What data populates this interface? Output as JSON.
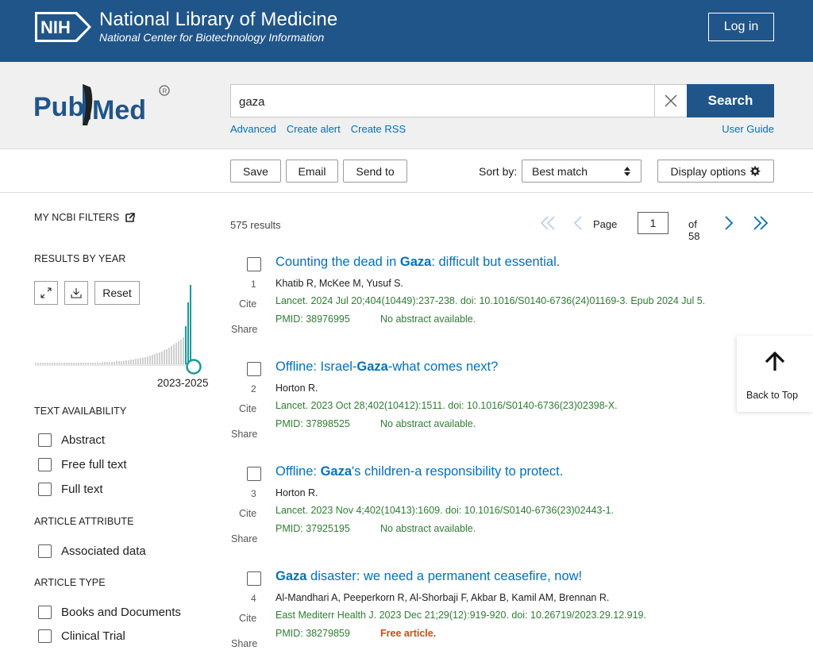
{
  "header": {
    "badge_text": "NIH",
    "title": "National Library of Medicine",
    "subtitle": "National Center for Biotechnology Information",
    "login_label": "Log in",
    "brand_color": "#20558a"
  },
  "search": {
    "logo_text": "PubMed",
    "query": "gaza",
    "button_label": "Search",
    "links": [
      "Advanced",
      "Create alert",
      "Create RSS"
    ],
    "user_guide": "User Guide"
  },
  "actions": {
    "save": "Save",
    "email": "Email",
    "send_to": "Send to",
    "sort_label": "Sort by:",
    "sort_value": "Best match",
    "display_options": "Display options"
  },
  "sidebar": {
    "my_filters": "MY NCBI FILTERS",
    "results_by_year": "RESULTS BY YEAR",
    "reset": "Reset",
    "year_range": "2023-2025",
    "text_availability": "TEXT AVAILABILITY",
    "text_filters": [
      "Abstract",
      "Free full text",
      "Full text"
    ],
    "article_attribute": "ARTICLE ATTRIBUTE",
    "attribute_filters": [
      "Associated data"
    ],
    "article_type": "ARTICLE TYPE",
    "type_filters": [
      "Books and Documents",
      "Clinical Trial"
    ]
  },
  "results_info": {
    "count": "575 results",
    "page_label": "Page",
    "page_value": "1",
    "page_of": "of 58"
  },
  "results": [
    {
      "num": "1",
      "title_pre": "Counting the dead in ",
      "title_bold": "Gaza",
      "title_post": ": difficult but essential.",
      "authors": "Khatib R, McKee M, Yusuf S.",
      "citation": "Lancet. 2024 Jul 20;404(10449):237-238. doi: 10.1016/S0140-6736(24)01169-3. Epub 2024 Jul 5.",
      "pmid": "PMID: 38976995",
      "note": "No abstract available.",
      "cite": "Cite",
      "share": "Share"
    },
    {
      "num": "2",
      "title_pre": "Offline: Israel-",
      "title_bold": "Gaza",
      "title_post": "-what comes next?",
      "authors": "Horton R.",
      "citation": "Lancet. 2023 Oct 28;402(10412):1511. doi: 10.1016/S0140-6736(23)02398-X.",
      "pmid": "PMID: 37898525",
      "note": "No abstract available.",
      "cite": "Cite",
      "share": "Share"
    },
    {
      "num": "3",
      "title_pre": "Offline: ",
      "title_bold": "Gaza",
      "title_post": "'s children-a responsibility to protect.",
      "authors": "Horton R.",
      "citation": "Lancet. 2023 Nov 4;402(10413):1609. doi: 10.1016/S0140-6736(23)02443-1.",
      "pmid": "PMID: 37925195",
      "note": "No abstract available.",
      "cite": "Cite",
      "share": "Share"
    },
    {
      "num": "4",
      "title_pre": "",
      "title_bold": "Gaza",
      "title_post": " disaster: we need a permanent ceasefire, now!",
      "authors": "Al-Mandhari A, Peeperkorn R, Al-Shorbaji F, Akbar B, Kamil AM, Brennan R.",
      "citation": "East Mediterr Health J. 2023 Dec 21;29(12):919-920. doi: 10.26719/2023.29.12.919.",
      "pmid": "PMID: 38279859",
      "note": "Free article.",
      "cite": "Cite",
      "share": "Share"
    }
  ],
  "back_to_top": "Back to Top",
  "colors": {
    "link": "#0071bc",
    "citation_green": "#2e7d32",
    "free_orange": "#c84d12",
    "timeline_bar": "#d0d0d0",
    "timeline_highlight": "#1a9a9a"
  }
}
